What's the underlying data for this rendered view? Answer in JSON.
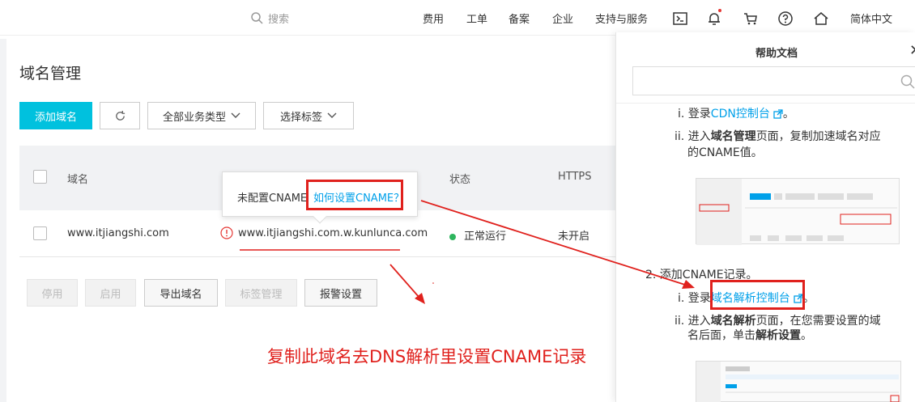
{
  "topnav": {
    "search_placeholder": "搜索",
    "items": [
      "费用",
      "工单",
      "备案",
      "企业",
      "支持与服务"
    ],
    "language": "简体中文",
    "icons": [
      "terminal-icon",
      "bell-icon",
      "cart-icon",
      "help-icon",
      "home-icon"
    ]
  },
  "page": {
    "title": "域名管理",
    "toolbar": {
      "add_domain": "添加域名",
      "business_type": "全部业务类型",
      "select_tag": "选择标签"
    }
  },
  "table": {
    "headers": {
      "domain": "域名",
      "status": "状态",
      "https": "HTTPS"
    },
    "rows": [
      {
        "domain": "www.itjiangshi.com",
        "cname": "www.itjiangshi.com.w.kunlunca.com",
        "status": "正常运行",
        "https": "未开启"
      }
    ]
  },
  "tooltip": {
    "text": "未配置CNAME",
    "link": "如何设置CNAME？"
  },
  "bulk_actions": {
    "disable": "停用",
    "enable": "启用",
    "export": "导出域名",
    "tag_manage": "标签管理",
    "alarm": "报警设置"
  },
  "annotation": "复制此域名去DNS解析里设置CNAME记录",
  "help": {
    "title": "帮助文档",
    "step_i1_prefix": "i. 登录",
    "step_i1_link": "CDN控制台",
    "step_ii1_a": "ii. 进入",
    "step_ii1_b": "域名管理",
    "step_ii1_c": "页面，复制加速域名对应",
    "step_ii1_d": "的CNAME值。",
    "step2": "2. 添加CNAME记录。",
    "step_i2_prefix": "i. 登录",
    "step_i2_link": "域名解析控制台",
    "step_ii2_a": "ii. 进入",
    "step_ii2_b": "域名解析",
    "step_ii2_c": "页面，在您需要设置的域",
    "step_ii2_d": "名后面，单击",
    "step_ii2_e": "解析设置",
    "step_ii2_f": "。"
  },
  "colors": {
    "primary": "#00c1de",
    "link": "#00a0e9",
    "annotation_red": "#e0211d",
    "status_green": "#2db55d"
  }
}
